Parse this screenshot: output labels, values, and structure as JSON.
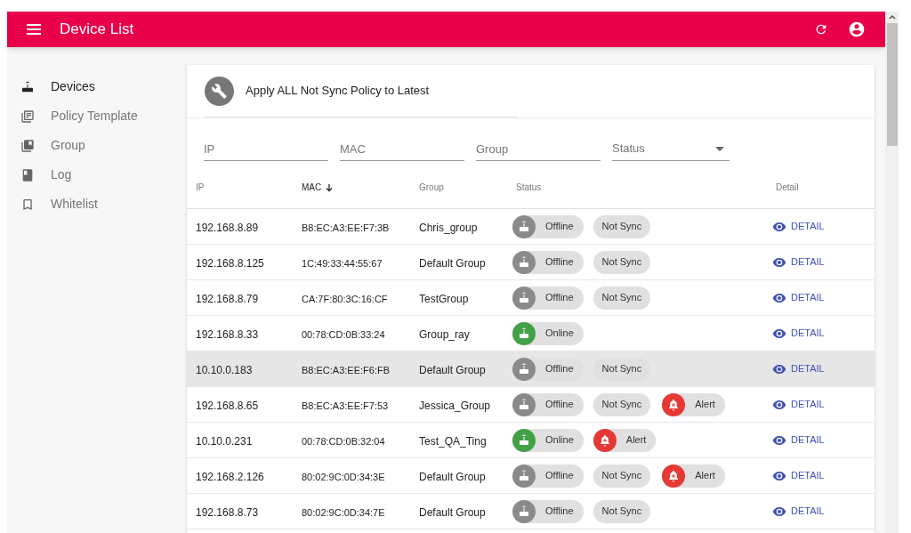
{
  "app_bar": {
    "title": "Device List"
  },
  "sidebar": {
    "items": [
      {
        "label": "Devices",
        "selected": true
      },
      {
        "label": "Policy Template",
        "selected": false
      },
      {
        "label": "Group",
        "selected": false
      },
      {
        "label": "Log",
        "selected": false
      },
      {
        "label": "Whitelist",
        "selected": false
      }
    ]
  },
  "action": {
    "label": "Apply ALL Not Sync Policy to Latest"
  },
  "filters": [
    {
      "placeholder": "IP",
      "kind": "text"
    },
    {
      "placeholder": "MAC",
      "kind": "text"
    },
    {
      "placeholder": "Group",
      "kind": "text"
    },
    {
      "placeholder": "Status",
      "kind": "select"
    }
  ],
  "table": {
    "columns": [
      {
        "label": "IP",
        "sorted": false
      },
      {
        "label": "MAC",
        "sorted": true
      },
      {
        "label": "Group",
        "sorted": false
      },
      {
        "label": "Status",
        "sorted": false
      },
      {
        "label": "Detail",
        "sorted": false
      }
    ],
    "rows": [
      {
        "ip": "192.168.8.89",
        "mac": "B8:EC:A3:EE:F7:3B",
        "group": "Chris_group",
        "status": {
          "label": "Offline",
          "online": false
        },
        "tags": [
          {
            "kind": "sync",
            "label": "Not Sync"
          }
        ],
        "detail": "DETAIL",
        "selected": false
      },
      {
        "ip": "192.168.8.125",
        "mac": "1C:49:33:44:55:67",
        "group": "Default Group",
        "status": {
          "label": "Offline",
          "online": false
        },
        "tags": [
          {
            "kind": "sync",
            "label": "Not Sync"
          }
        ],
        "detail": "DETAIL",
        "selected": false
      },
      {
        "ip": "192.168.8.79",
        "mac": "CA:7F:80:3C:16:CF",
        "group": "TestGroup",
        "status": {
          "label": "Offline",
          "online": false
        },
        "tags": [
          {
            "kind": "sync",
            "label": "Not Sync"
          }
        ],
        "detail": "DETAIL",
        "selected": false
      },
      {
        "ip": "192.168.8.33",
        "mac": "00:78:CD:0B:33:24",
        "group": "Group_ray",
        "status": {
          "label": "Online",
          "online": true
        },
        "detail": "DETAIL",
        "selected": false
      },
      {
        "ip": "10.10.0.183",
        "mac": "B8:EC:A3:EE:F6:FB",
        "group": "Default Group",
        "status": {
          "label": "Offline",
          "online": false
        },
        "tags": [
          {
            "kind": "sync",
            "label": "Not Sync"
          }
        ],
        "detail": "DETAIL",
        "selected": true
      },
      {
        "ip": "192.168.8.65",
        "mac": "B8:EC:A3:EE:F7:53",
        "group": "Jessica_Group",
        "status": {
          "label": "Offline",
          "online": false
        },
        "tags": [
          {
            "kind": "sync",
            "label": "Not Sync"
          },
          {
            "kind": "alert",
            "label": "Alert"
          }
        ],
        "detail": "DETAIL",
        "selected": false
      },
      {
        "ip": "10.10.0.231",
        "mac": "00:78:CD:0B:32:04",
        "group": "Test_QA_Ting",
        "status": {
          "label": "Online",
          "online": true
        },
        "tags": [
          {
            "kind": "alert",
            "label": "Alert"
          }
        ],
        "detail": "DETAIL",
        "selected": false
      },
      {
        "ip": "192.168.2.126",
        "mac": "80:02:9C:0D:34:3E",
        "group": "Default Group",
        "status": {
          "label": "Offline",
          "online": false
        },
        "tags": [
          {
            "kind": "sync",
            "label": "Not Sync"
          },
          {
            "kind": "alert",
            "label": "Alert"
          }
        ],
        "detail": "DETAIL",
        "selected": false
      },
      {
        "ip": "192.168.8.73",
        "mac": "80:02:9C:0D:34:7E",
        "group": "Default Group",
        "status": {
          "label": "Offline",
          "online": false
        },
        "tags": [
          {
            "kind": "sync",
            "label": "Not Sync"
          }
        ],
        "detail": "DETAIL",
        "selected": false
      }
    ]
  }
}
